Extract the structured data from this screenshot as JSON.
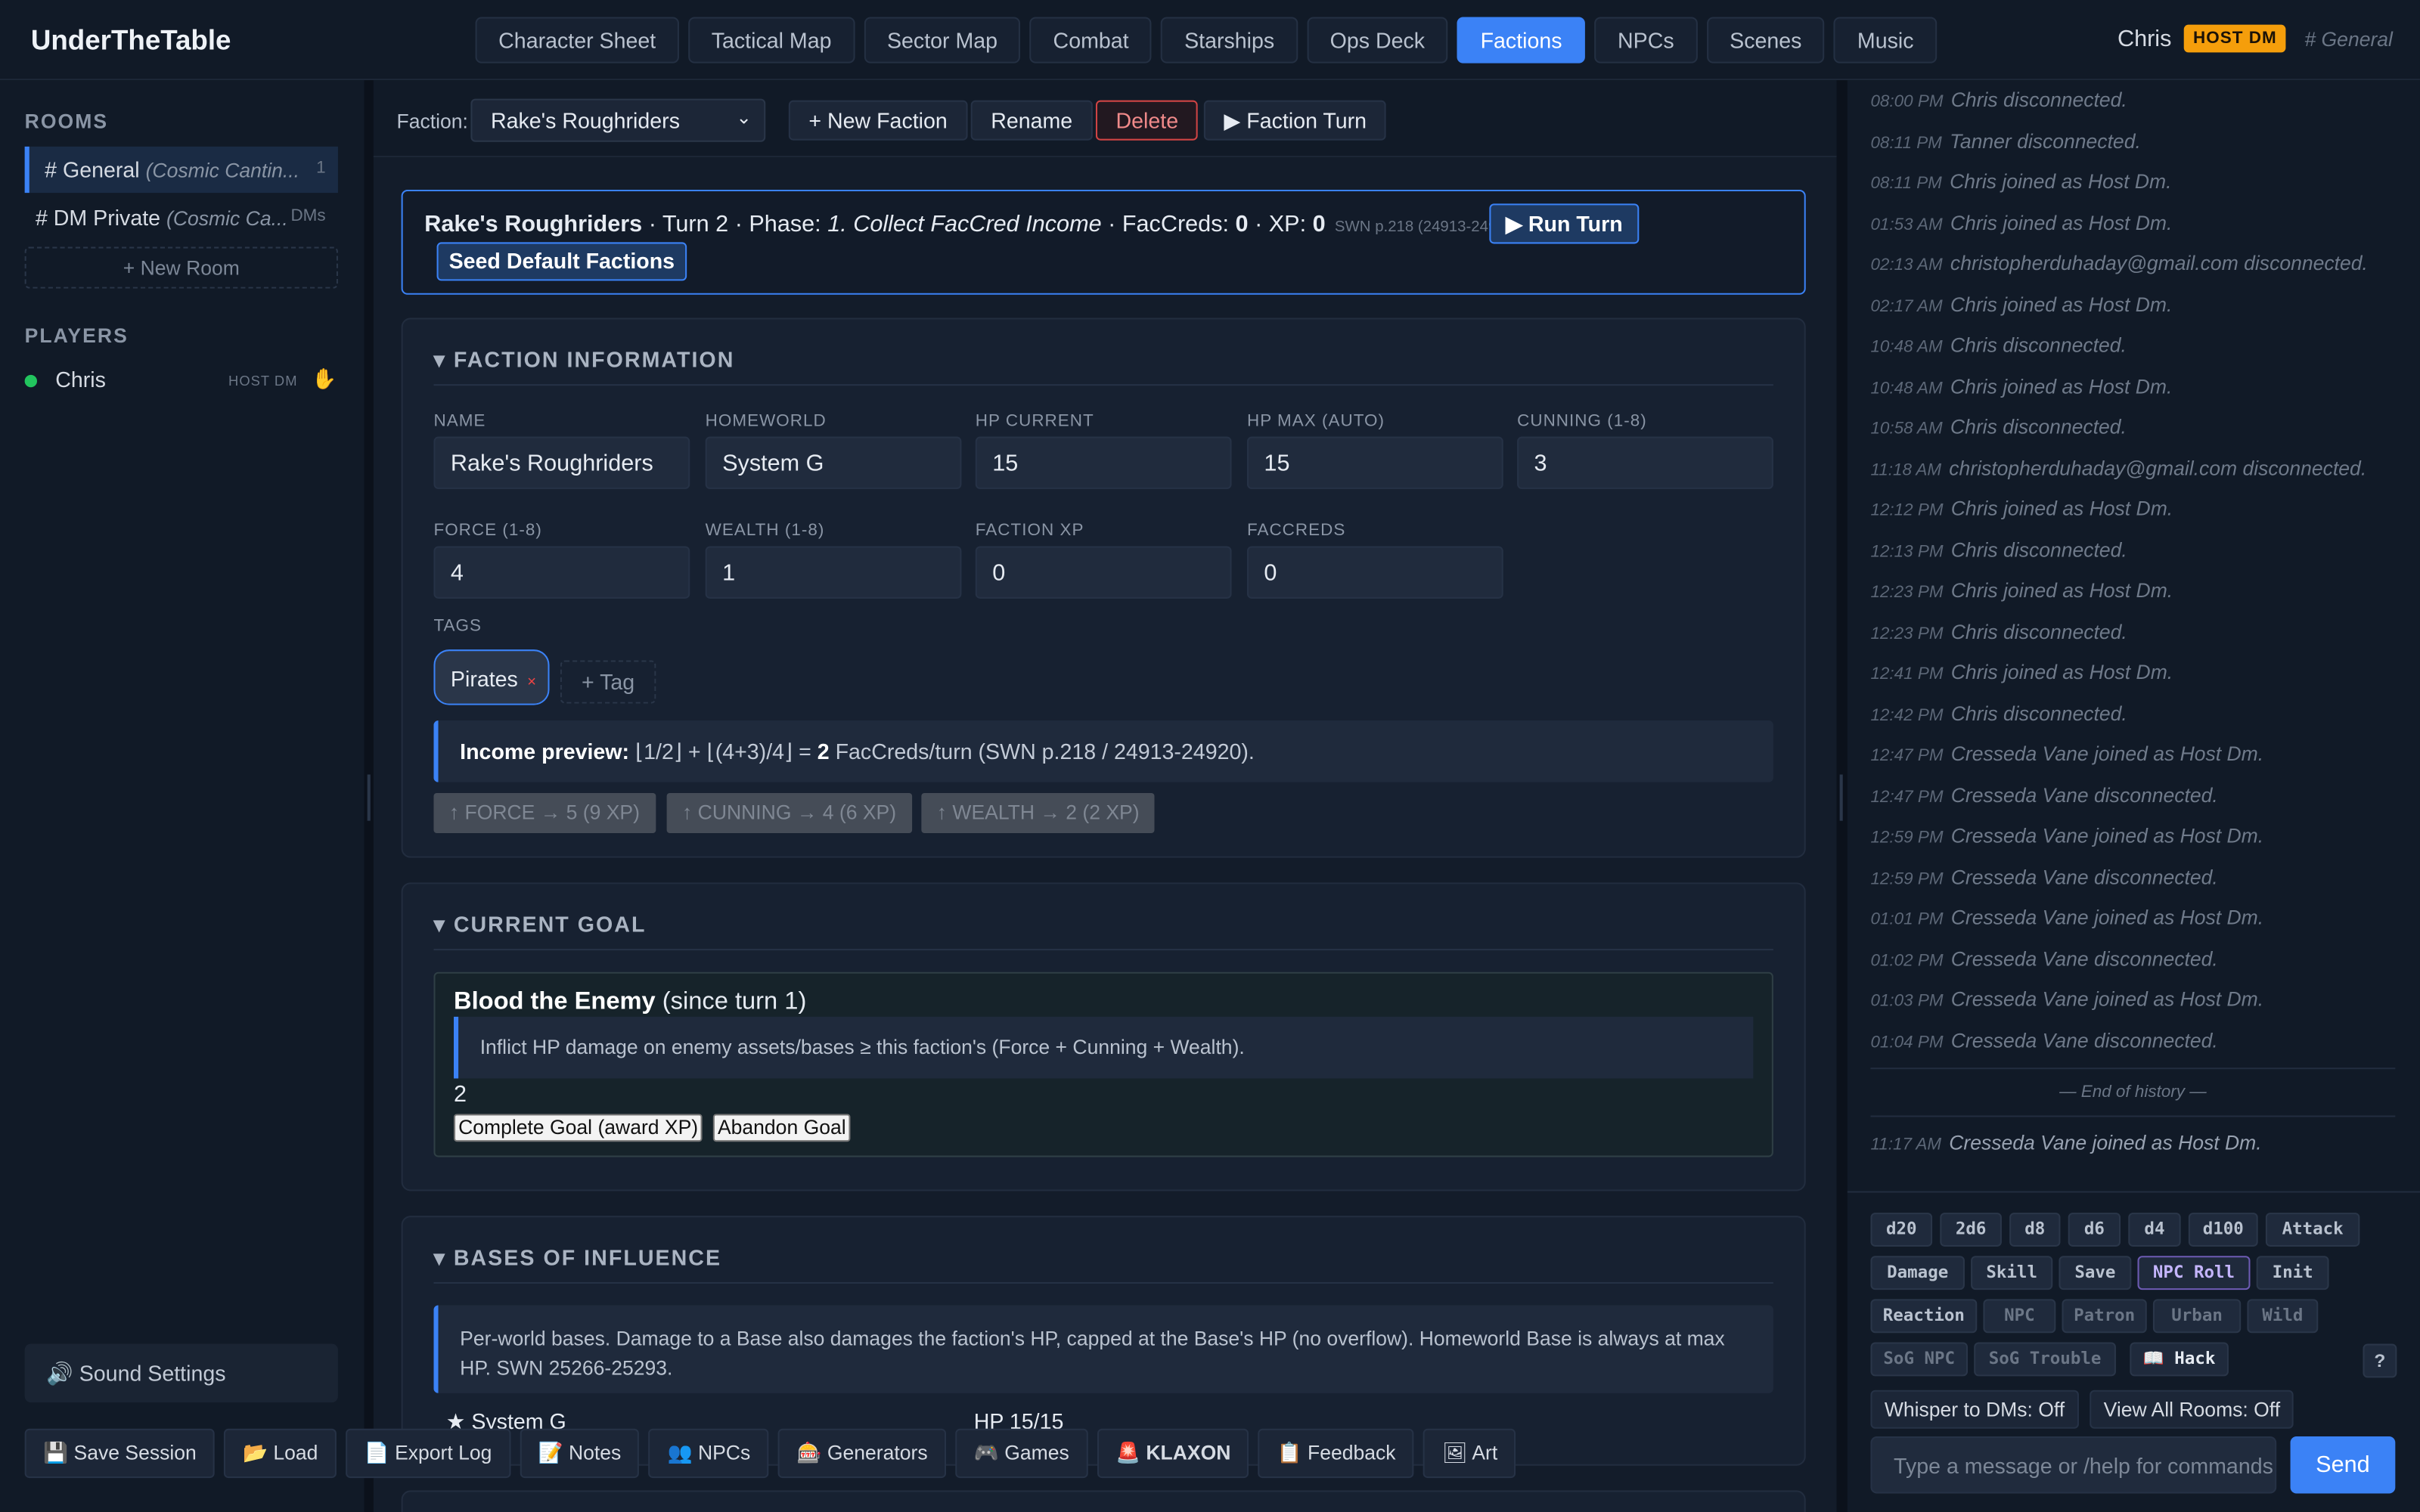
{
  "app": {
    "title": "UnderTheTable"
  },
  "nav": {
    "tabs": [
      {
        "label": "Character Sheet"
      },
      {
        "label": "Tactical Map"
      },
      {
        "label": "Sector Map"
      },
      {
        "label": "Combat"
      },
      {
        "label": "Starships"
      },
      {
        "label": "Ops Deck"
      },
      {
        "label": "Factions",
        "active": true
      },
      {
        "label": "NPCs"
      },
      {
        "label": "Scenes"
      },
      {
        "label": "Music"
      }
    ]
  },
  "user": {
    "name": "Chris",
    "badge": "HOST DM",
    "room": "# General"
  },
  "sidebar": {
    "rooms_title": "ROOMS",
    "rooms": [
      {
        "name": "# General",
        "sub": "(Cosmic Cantin...",
        "count": "1"
      },
      {
        "name": "# DM Private",
        "sub": "(Cosmic Ca...",
        "count": "DMs"
      }
    ],
    "new_room": "+ New Room",
    "players_title": "PLAYERS",
    "players": [
      {
        "name": "Chris",
        "role": "HOST DM"
      }
    ],
    "sound_settings": "🔊 Sound Settings"
  },
  "toolbar": {
    "faction_label": "Faction:",
    "selected_faction": "Rake's Roughriders",
    "new_faction": "+ New Faction",
    "rename": "Rename",
    "delete": "Delete",
    "faction_turn": "▶ Faction Turn"
  },
  "turn": {
    "faction": "Rake's Roughriders",
    "turn_text": " · Turn 2 · Phase: ",
    "phase": "1. Collect FacCred Income",
    "faccreds_label": " · FacCreds: ",
    "faccreds": "0",
    "xp_label": " · XP: ",
    "xp": "0",
    "ref": "SWN p.218 (24913-24935)",
    "run_turn": "▶ Run Turn",
    "seed": "Seed Default Factions"
  },
  "faction_info": {
    "title": "▾ FACTION INFORMATION",
    "fields": [
      {
        "label": "NAME",
        "value": "Rake's Roughriders"
      },
      {
        "label": "HOMEWORLD",
        "value": "System G"
      },
      {
        "label": "HP CURRENT",
        "value": "15"
      },
      {
        "label": "HP MAX (AUTO)",
        "value": "15"
      },
      {
        "label": "CUNNING (1-8)",
        "value": "3"
      },
      {
        "label": "FORCE (1-8)",
        "value": "4"
      },
      {
        "label": "WEALTH (1-8)",
        "value": "1"
      },
      {
        "label": "FACTION XP",
        "value": "0"
      },
      {
        "label": "FACCREDS",
        "value": "0"
      }
    ],
    "tags_label": "TAGS",
    "tag": "Pirates",
    "tag_remove": "×",
    "add_tag": "+ Tag",
    "income_label": "Income preview:",
    "income_formula": " ⌊1/2⌋ + ⌊(4+3)/4⌋ = ",
    "income_value": "2",
    "income_suffix": " FacCreds/turn (SWN p.218 / 24913-24920).",
    "upgrades": [
      {
        "label": "↑ FORCE → 5 (9 XP)"
      },
      {
        "label": "↑ CUNNING → 4 (6 XP)"
      },
      {
        "label": "↑ WEALTH → 2 (2 XP)"
      }
    ]
  },
  "goal": {
    "title": "▾ CURRENT GOAL",
    "name": "Blood the Enemy",
    "since": " (since turn 1)",
    "description": "Inflict HP damage on enemy assets/bases ≥ this faction's (Force + Cunning + Wealth).",
    "progress": "2",
    "complete": "Complete Goal (award XP)",
    "abandon": "Abandon Goal"
  },
  "bases": {
    "title": "▾ BASES OF INFLUENCE",
    "note": "Per-world bases. Damage to a Base also damages the faction's HP, capped at the Base's HP (no overflow). Homeworld Base is always at max HP. SWN 25266-25293.",
    "rows": [
      {
        "name": "★ System G",
        "hp": "HP 15/15"
      }
    ]
  },
  "footer": {
    "buttons": [
      {
        "label": "💾 Save Session"
      },
      {
        "label": "📂 Load"
      },
      {
        "label": "📄 Export Log"
      },
      {
        "label": "📝 Notes"
      },
      {
        "label": "👥 NPCs"
      },
      {
        "label": "🎰 Generators"
      },
      {
        "label": "🎮 Games"
      },
      {
        "label": "🚨 KLAXON"
      },
      {
        "label": "📋 Feedback"
      },
      {
        "label": "🖼 Art"
      }
    ]
  },
  "chat": {
    "messages": [
      {
        "time": "08:00 PM",
        "text": "Chris disconnected."
      },
      {
        "time": "08:11 PM",
        "text": "Tanner disconnected."
      },
      {
        "time": "08:11 PM",
        "text": "Chris joined as Host Dm."
      },
      {
        "time": "01:53 AM",
        "text": "Chris joined as Host Dm."
      },
      {
        "time": "02:13 AM",
        "text": "christopherduhaday@gmail.com disconnected."
      },
      {
        "time": "02:17 AM",
        "text": "Chris joined as Host Dm."
      },
      {
        "time": "10:48 AM",
        "text": "Chris disconnected."
      },
      {
        "time": "10:48 AM",
        "text": "Chris joined as Host Dm."
      },
      {
        "time": "10:58 AM",
        "text": "Chris disconnected."
      },
      {
        "time": "11:18 AM",
        "text": "christopherduhaday@gmail.com disconnected."
      },
      {
        "time": "12:12 PM",
        "text": "Chris joined as Host Dm."
      },
      {
        "time": "12:13 PM",
        "text": "Chris disconnected."
      },
      {
        "time": "12:23 PM",
        "text": "Chris joined as Host Dm."
      },
      {
        "time": "12:23 PM",
        "text": "Chris disconnected."
      },
      {
        "time": "12:41 PM",
        "text": "Chris joined as Host Dm."
      },
      {
        "time": "12:42 PM",
        "text": "Chris disconnected."
      },
      {
        "time": "12:47 PM",
        "text": "Cresseda Vane joined as Host Dm."
      },
      {
        "time": "12:47 PM",
        "text": "Cresseda Vane disconnected."
      },
      {
        "time": "12:59 PM",
        "text": "Cresseda Vane joined as Host Dm."
      },
      {
        "time": "12:59 PM",
        "text": "Cresseda Vane disconnected."
      },
      {
        "time": "01:01 PM",
        "text": "Cresseda Vane joined as Host Dm."
      },
      {
        "time": "01:02 PM",
        "text": "Cresseda Vane disconnected."
      },
      {
        "time": "01:03 PM",
        "text": "Cresseda Vane joined as Host Dm."
      },
      {
        "time": "01:04 PM",
        "text": "Cresseda Vane disconnected."
      }
    ],
    "end_of_history": "— End of history —",
    "recent": {
      "time": "11:17 AM",
      "text": "Cresseda Vane joined as Host Dm."
    }
  },
  "dice": {
    "row1": [
      "d20",
      "2d6",
      "d8",
      "d6",
      "d4",
      "d100",
      "Attack"
    ],
    "row2": [
      "Damage",
      "Skill",
      "Save",
      "NPC Roll",
      "Init"
    ],
    "row3": [
      "Reaction",
      "NPC",
      "Patron",
      "Urban",
      "Wild"
    ],
    "row4": [
      "SoG NPC",
      "SoG Trouble",
      "📖 Hack"
    ],
    "help": "?",
    "whisper": "Whisper to DMs: Off",
    "view_all": "View All Rooms: Off",
    "input_placeholder": "Type a message or /help for commands",
    "send": "Send"
  }
}
